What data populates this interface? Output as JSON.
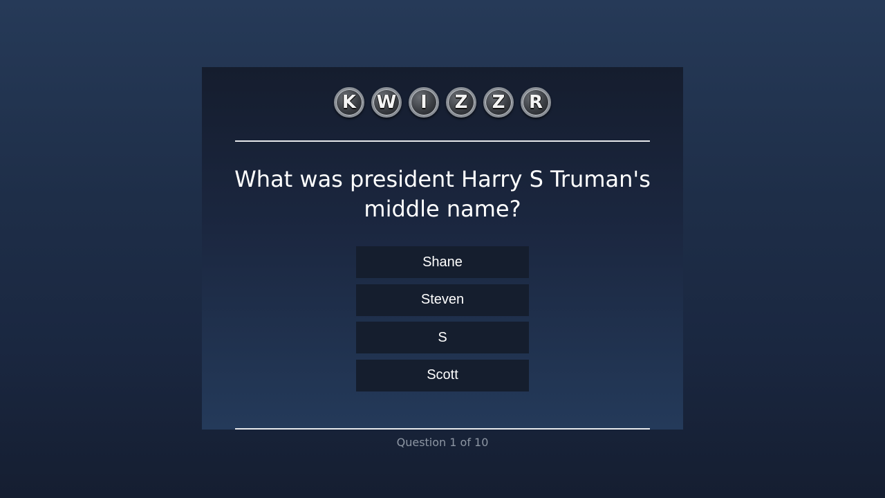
{
  "logo": {
    "letters": [
      "K",
      "W",
      "I",
      "Z",
      "Z",
      "R"
    ]
  },
  "question": {
    "line1": "What was president Harry S Truman's",
    "line2": "middle name?"
  },
  "answers": [
    {
      "label": "Shane"
    },
    {
      "label": "Steven"
    },
    {
      "label": "S"
    },
    {
      "label": "Scott"
    }
  ],
  "progress": {
    "text": "Question 1 of 10"
  }
}
